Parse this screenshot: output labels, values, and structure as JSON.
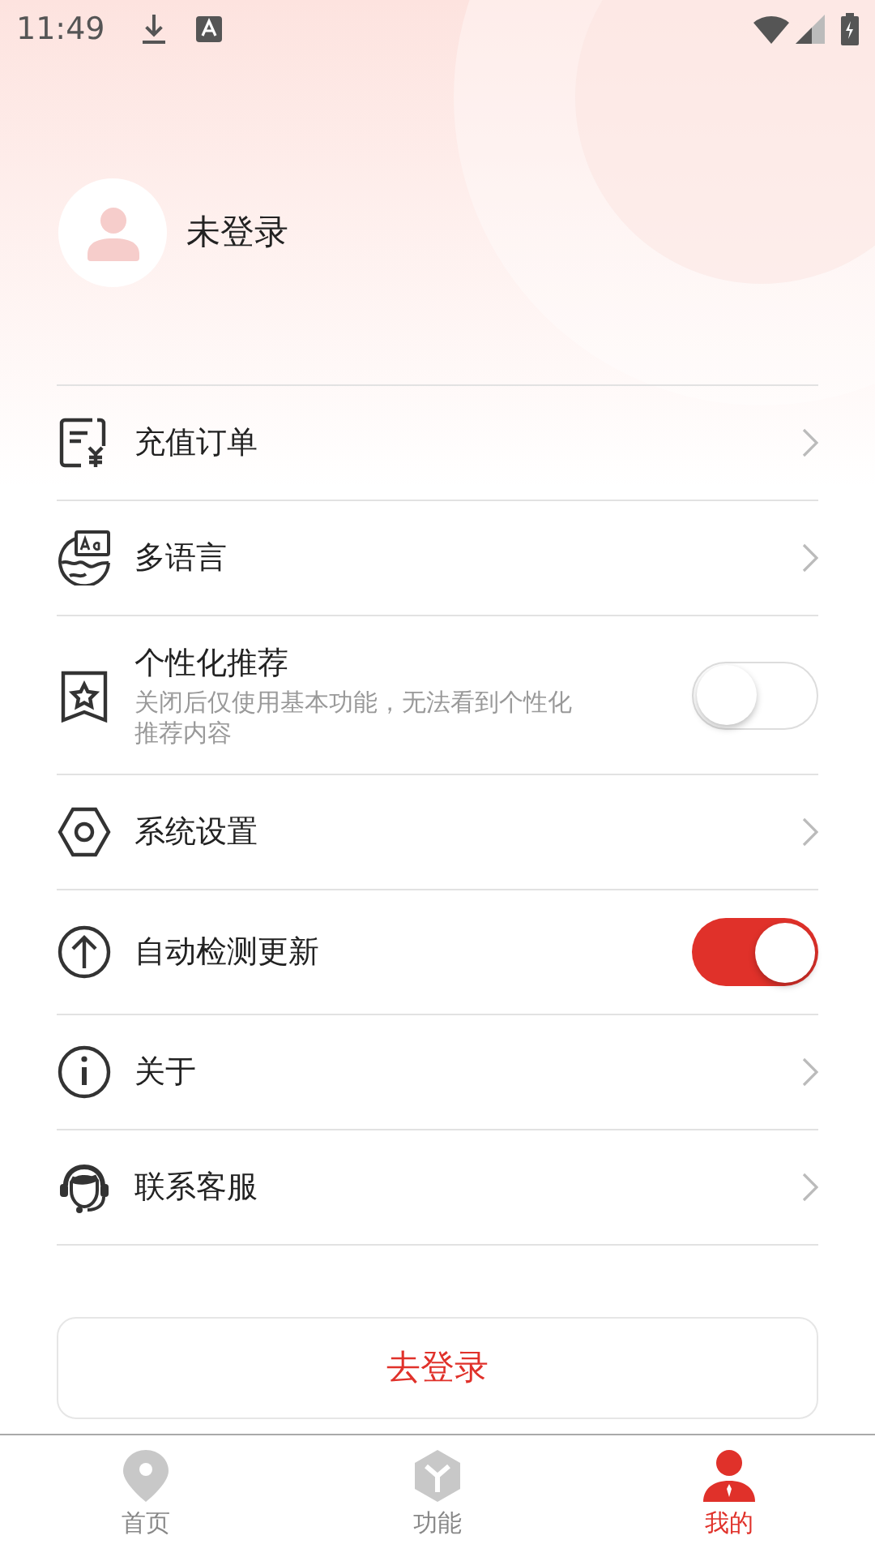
{
  "status_bar": {
    "time": "11:49"
  },
  "profile": {
    "name": "未登录"
  },
  "menu": [
    {
      "kind": "link",
      "label": "充值订单"
    },
    {
      "kind": "link",
      "label": "多语言"
    },
    {
      "kind": "toggle",
      "label": "个性化推荐",
      "description": "关闭后仅使用基本功能，无法看到个性化推荐内容",
      "on": false
    },
    {
      "kind": "link",
      "label": "系统设置"
    },
    {
      "kind": "toggle",
      "label": "自动检测更新",
      "on": true
    },
    {
      "kind": "link",
      "label": "关于"
    },
    {
      "kind": "link",
      "label": "联系客服"
    }
  ],
  "login_button": "去登录",
  "tabs": [
    {
      "label": "首页",
      "selected": false
    },
    {
      "label": "功能",
      "selected": false
    },
    {
      "label": "我的",
      "selected": true
    }
  ]
}
